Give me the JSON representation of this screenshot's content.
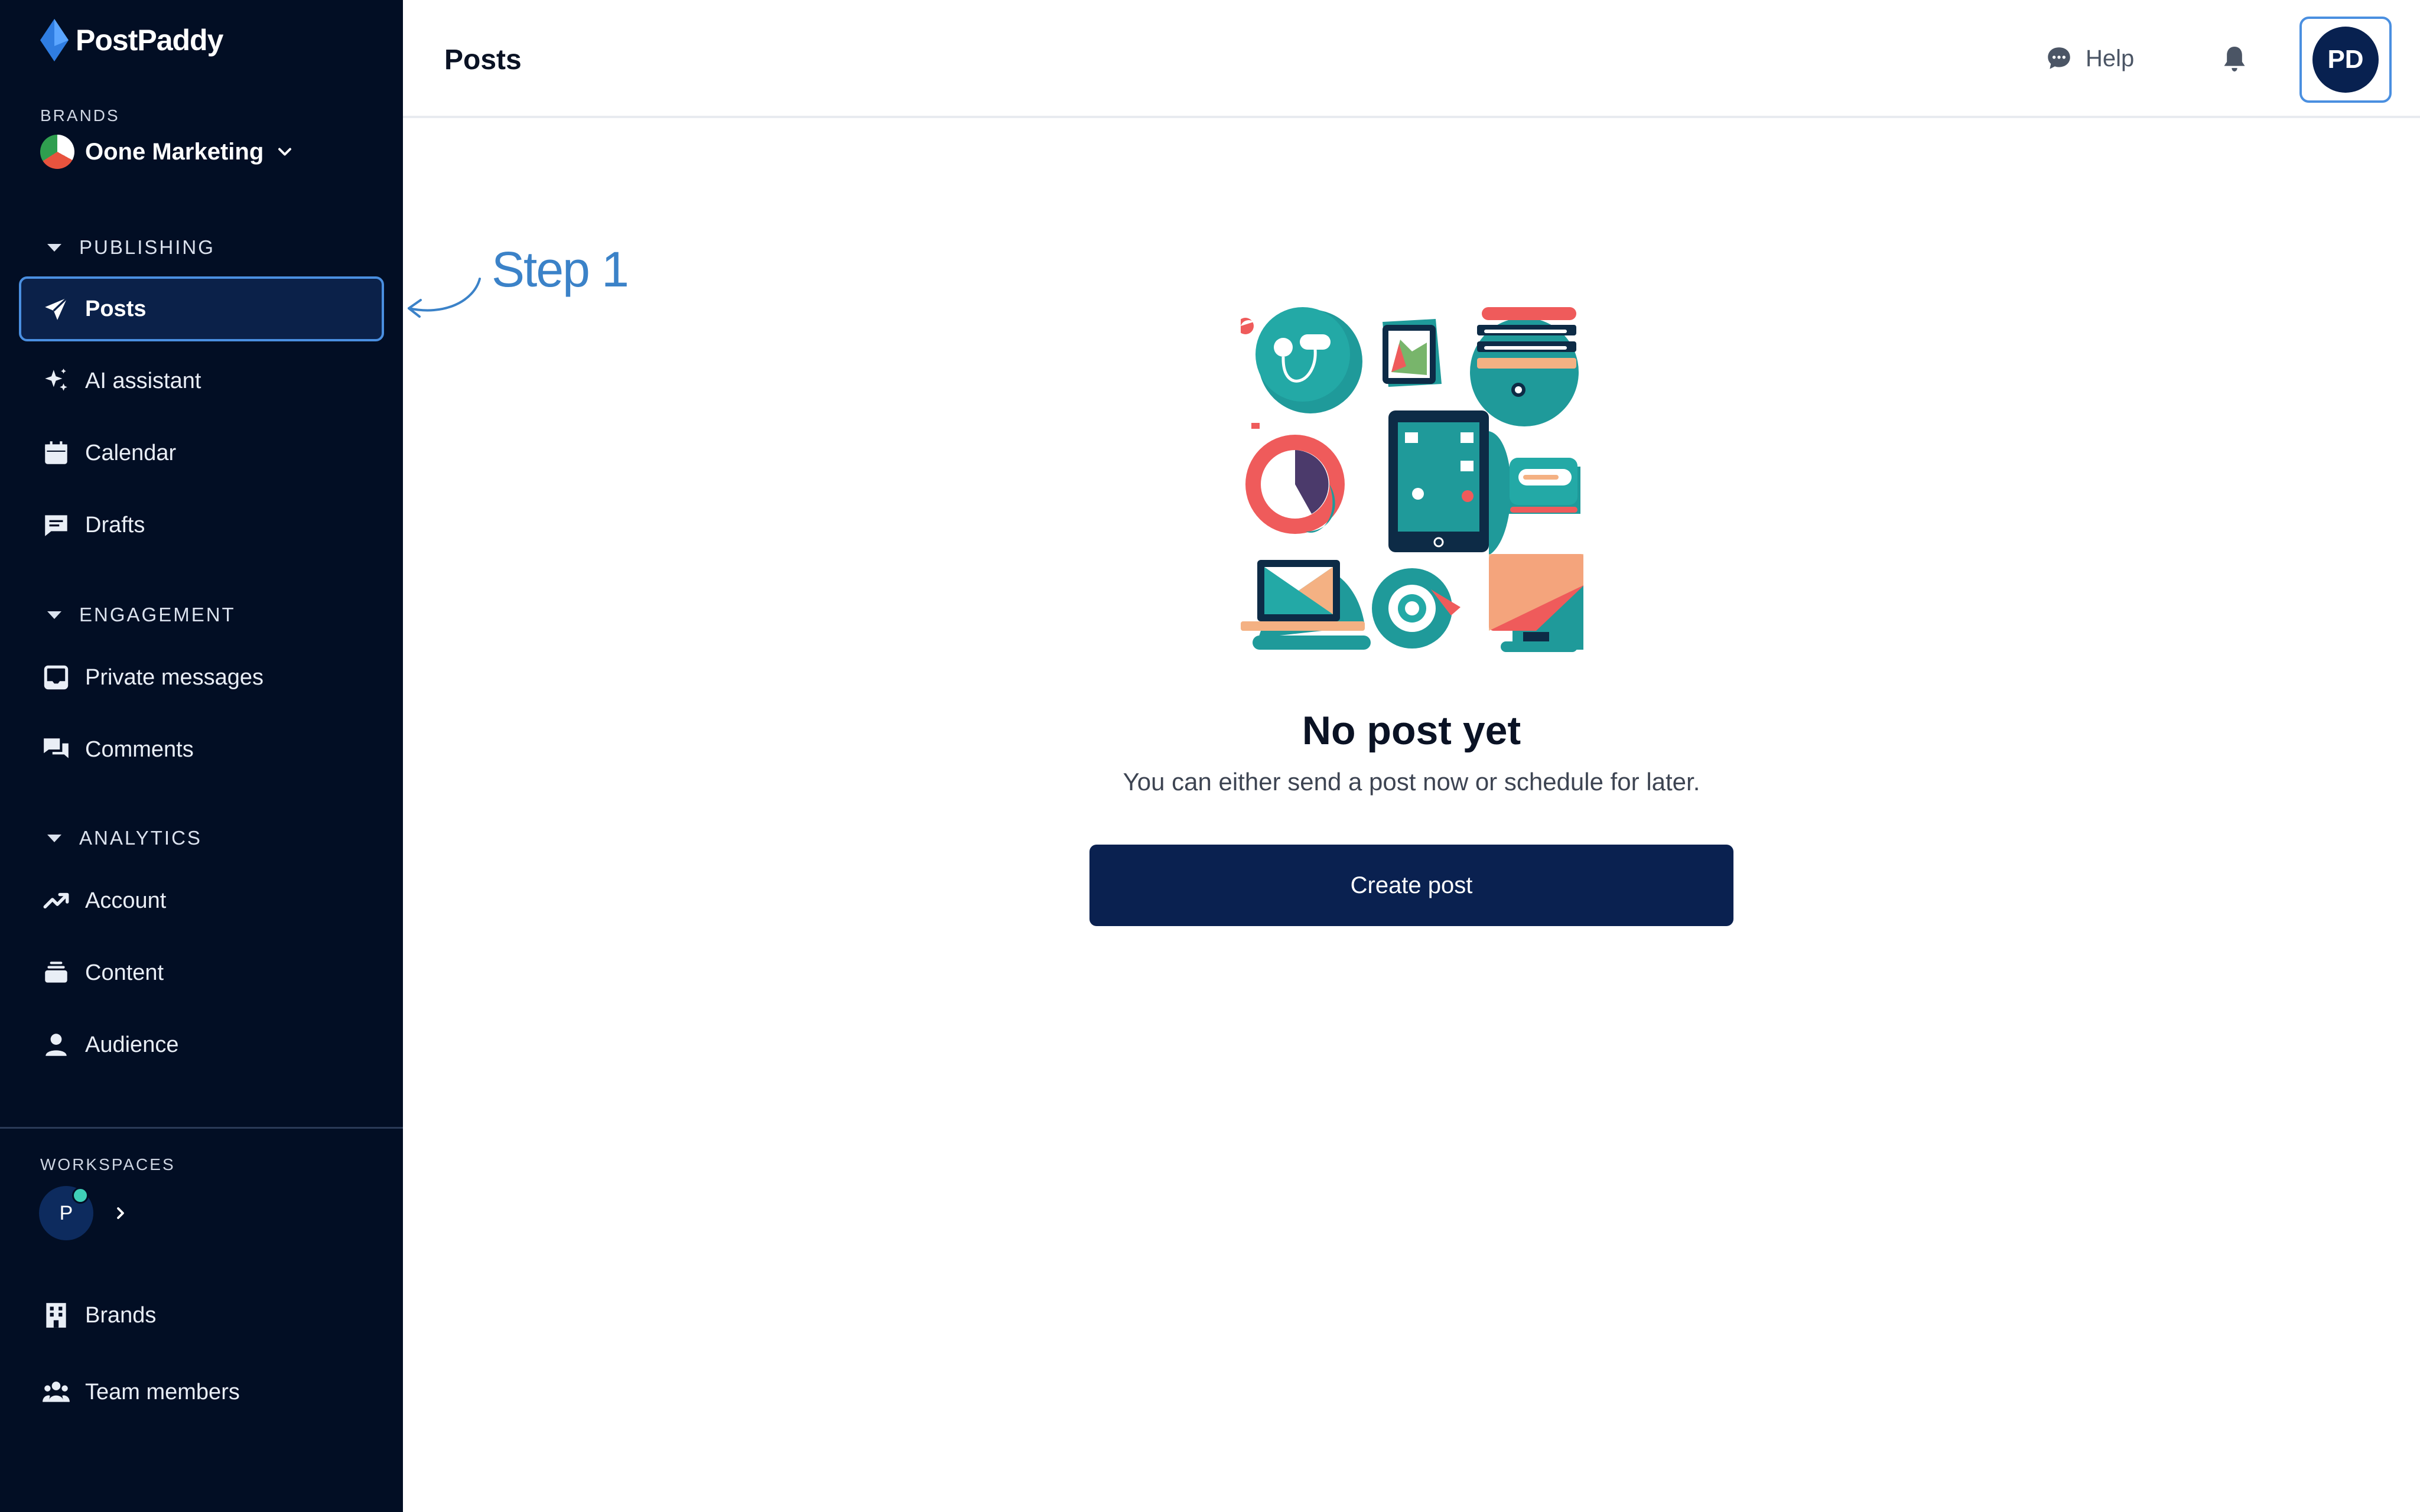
{
  "app": {
    "name": "PostPaddy"
  },
  "sidebar": {
    "brands_caption": "BRANDS",
    "brand_name": "Oone Marketing",
    "sections": {
      "publishing": "PUBLISHING",
      "engagement": "ENGAGEMENT",
      "analytics": "ANALYTICS"
    },
    "items": {
      "posts": "Posts",
      "ai_assistant": "AI assistant",
      "calendar": "Calendar",
      "drafts": "Drafts",
      "private_messages": "Private messages",
      "comments": "Comments",
      "account": "Account",
      "content": "Content",
      "audience": "Audience",
      "brands": "Brands",
      "team_members": "Team members"
    },
    "workspaces_caption": "WORKSPACES",
    "workspace_initial": "P"
  },
  "header": {
    "title": "Posts",
    "help_label": "Help",
    "user_initials": "PD"
  },
  "annotation": {
    "step_label": "Step 1"
  },
  "empty_state": {
    "title": "No post yet",
    "subtitle": "You can either send a post now or schedule for later.",
    "cta_label": "Create post"
  },
  "colors": {
    "sidebar_bg": "#020e24",
    "active_bg": "#0b2149",
    "accent": "#4a8fe0",
    "primary_button": "#0a2150",
    "teal": "#1f9a9a",
    "coral": "#ef5b5b"
  }
}
